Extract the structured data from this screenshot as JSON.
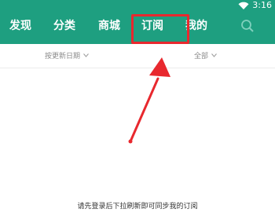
{
  "status_bar": {
    "time": "3:16"
  },
  "tabs": [
    {
      "label": "发现"
    },
    {
      "label": "分类"
    },
    {
      "label": "商城"
    },
    {
      "label": "订阅",
      "highlighted": true
    },
    {
      "label": "我的"
    }
  ],
  "filters": {
    "sort": {
      "label": "按更新日期"
    },
    "scope": {
      "label": "全部"
    }
  },
  "empty_message": "请先登录后下拉刷新即可同步我的订阅",
  "colors": {
    "header": "#1e9f80",
    "annotation_red": "#e8282e"
  }
}
